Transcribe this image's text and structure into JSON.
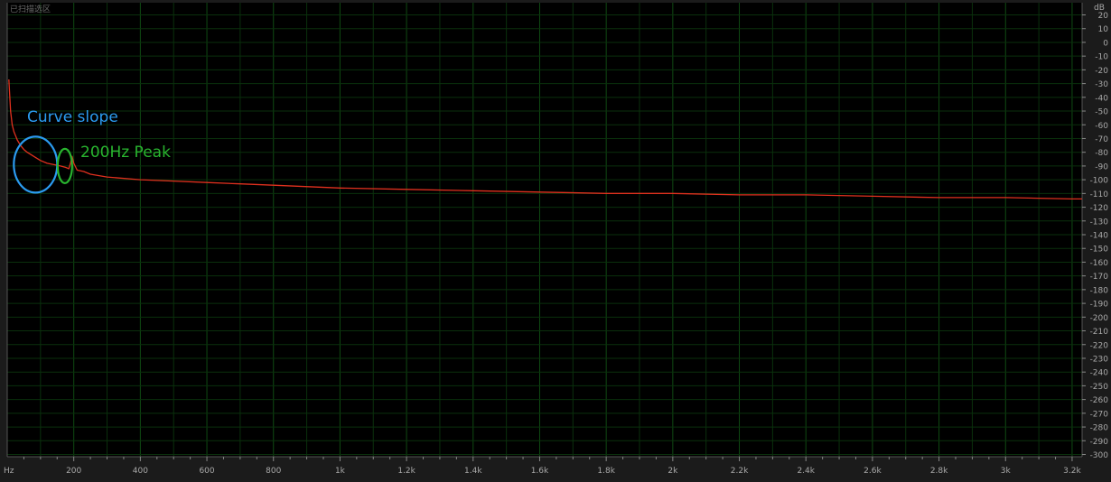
{
  "window": {
    "title": "已扫描选区"
  },
  "chart_data": {
    "type": "line",
    "x_unit_label": "Hz",
    "y_unit_label": "dB",
    "xlim": [
      0,
      3230
    ],
    "ylim": [
      -300,
      20
    ],
    "x_ticks": [
      {
        "value": 200,
        "label": "200"
      },
      {
        "value": 400,
        "label": "400"
      },
      {
        "value": 600,
        "label": "600"
      },
      {
        "value": 800,
        "label": "800"
      },
      {
        "value": 1000,
        "label": "1k"
      },
      {
        "value": 1200,
        "label": "1.2k"
      },
      {
        "value": 1400,
        "label": "1.4k"
      },
      {
        "value": 1600,
        "label": "1.6k"
      },
      {
        "value": 1800,
        "label": "1.8k"
      },
      {
        "value": 2000,
        "label": "2k"
      },
      {
        "value": 2200,
        "label": "2.2k"
      },
      {
        "value": 2400,
        "label": "2.4k"
      },
      {
        "value": 2600,
        "label": "2.6k"
      },
      {
        "value": 2800,
        "label": "2.8k"
      },
      {
        "value": 3000,
        "label": "3k"
      },
      {
        "value": 3200,
        "label": "3.2k"
      }
    ],
    "y_ticks": [
      20,
      10,
      0,
      -10,
      -20,
      -30,
      -40,
      -50,
      -60,
      -70,
      -80,
      -90,
      -100,
      -110,
      -120,
      -130,
      -140,
      -150,
      -160,
      -170,
      -180,
      -190,
      -200,
      -210,
      -220,
      -230,
      -240,
      -250,
      -260,
      -270,
      -280,
      -290,
      -300
    ],
    "grid": true,
    "series": [
      {
        "color": "#e0301e",
        "x": [
          5,
          10,
          15,
          20,
          30,
          40,
          50,
          60,
          80,
          100,
          120,
          140,
          160,
          175,
          185,
          190,
          195,
          200,
          210,
          230,
          250,
          300,
          400,
          500,
          600,
          700,
          800,
          1000,
          1200,
          1400,
          1600,
          1800,
          2000,
          2200,
          2400,
          2600,
          2800,
          3000,
          3200,
          3230
        ],
        "y": [
          -27,
          -50,
          -60,
          -65,
          -71,
          -75,
          -78,
          -80,
          -83,
          -86,
          -88,
          -89,
          -90,
          -91,
          -92,
          -88,
          -83,
          -88,
          -93,
          -94,
          -96,
          -98,
          -100,
          -101,
          -102,
          -103,
          -104,
          -106,
          -107,
          -108,
          -109,
          -110,
          -110,
          -111,
          -111,
          -112,
          -113,
          -113,
          -114,
          -114
        ]
      }
    ],
    "annotations": [
      {
        "text": "Curve slope",
        "color": "#2b9bf0",
        "x": 85,
        "y": -89
      },
      {
        "text": "200Hz Peak",
        "color": "#29b52f",
        "x": 195,
        "y": -90
      }
    ]
  }
}
